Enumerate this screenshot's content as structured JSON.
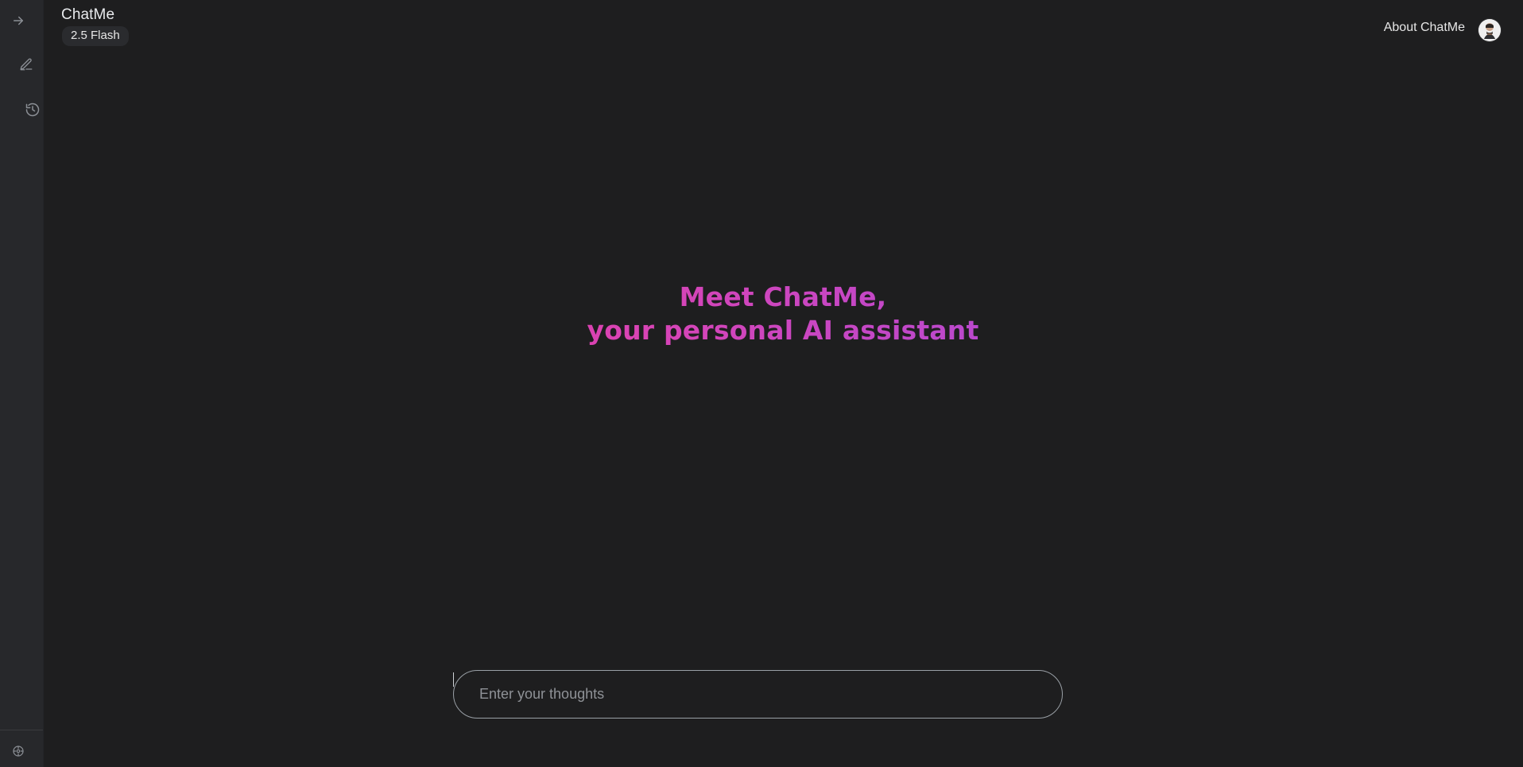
{
  "app": {
    "title": "ChatMe",
    "model_badge": "2.5 Flash"
  },
  "header": {
    "about_label": "About ChatMe"
  },
  "sidebar": {
    "items": [
      {
        "name": "expand",
        "icon": "arrow-right-icon"
      },
      {
        "name": "new-chat",
        "icon": "edit-icon"
      },
      {
        "name": "history",
        "icon": "history-icon"
      },
      {
        "name": "settings",
        "icon": "settings-icon"
      }
    ]
  },
  "hero": {
    "line1": "Meet ChatMe,",
    "line2": "your personal AI assistant"
  },
  "composer": {
    "placeholder": "Enter your thoughts",
    "value": ""
  },
  "theme": {
    "background": "#1e1e1f",
    "sidebar_background": "#27282b",
    "text": "#e8eaed",
    "muted_icon": "#8c9096",
    "gradient_start": "#e52b83",
    "gradient_mid": "#d944b5",
    "gradient_end": "#8a4ff3"
  }
}
